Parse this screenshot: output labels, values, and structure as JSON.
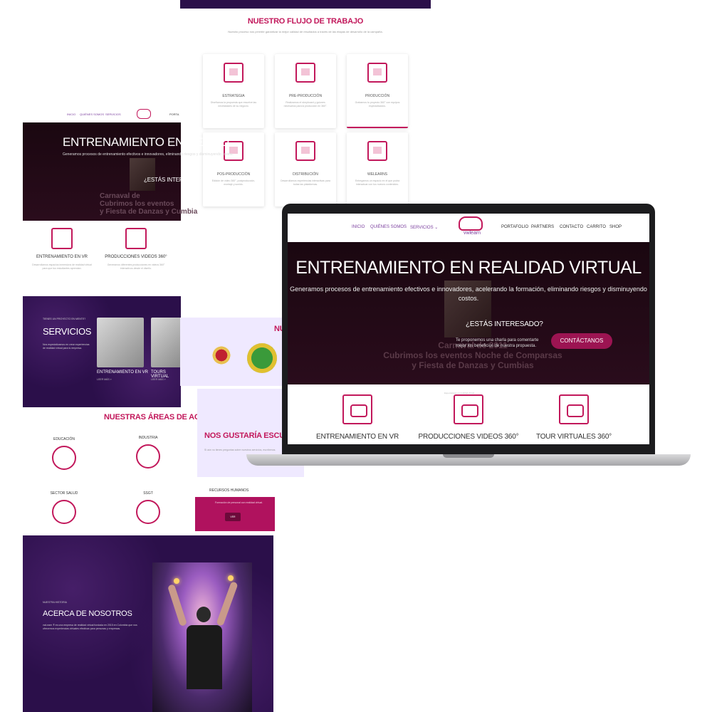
{
  "workflow": {
    "title": "NUESTRO FLUJO DE TRABAJO",
    "subtitle": "Nuestro proceso nos permite garantizar la mejor calidad de resultados a través de las etapas de desarrollo de la campaña.",
    "cards": [
      {
        "label": "ESTRATEGIA",
        "text": "Diseñamos la propuesta que resuelve las necesidades de su negocio."
      },
      {
        "label": "PRE-PRODUCCIÓN",
        "text": "Realizamos el storyboard y guiones necesarios para la producción en 360°."
      },
      {
        "label": "PRODUCCIÓN",
        "text": "Grabamos tu proyecto 360° con equipos especializados."
      },
      {
        "label": "POS-PRODUCCIÓN",
        "text": "Edición de video 360°, postproducción, montaje y sonido."
      },
      {
        "label": "DISTRIBUCIÓN",
        "text": "Desarrollamos experiencias interactivas para todas las plataformas."
      },
      {
        "label": "WELEARNS",
        "text": "Entregamos un espacio en el que podrá interactuar con tus nuevos contenidos."
      }
    ]
  },
  "left_page": {
    "nav": [
      "INICIO",
      "QUIÉNES SOMOS",
      "SERVICIOS",
      "PORTA"
    ],
    "hero": {
      "title": "ENTRENAMIENTO EN REALID",
      "text": "Generamos procesos de entrenamiento efectivos e innovadores, eliminando riesgos y disminuyendo costos.",
      "question": "¿ESTÁS INTERESAD",
      "carnaval": "Carnaval de\nCubrimos los eventos\ny Fiesta de Danzas y Cumbia"
    },
    "services": [
      {
        "name": "ENTRENAMIENTO EN VR",
        "desc": "Desarrollamos espacios inmersivos de realidad virtual para que tus estudiantes aprendan."
      },
      {
        "name": "PRODUCCIONES VIDEOS 360°",
        "desc": "Generamos diferentes producciones en videos 360° interactivos desde el diseño."
      }
    ],
    "servicios": {
      "tag": "TIENES UN PROYECTO EN MENTE?",
      "title": "SERVICIOS",
      "desc": "Nos especializamos en crear experiencias de realidad virtual para tu empresa.",
      "items": [
        {
          "name": "ENTRENAMIENTO EN VR",
          "more": "LEER MÁS »"
        },
        {
          "name": "TOURS VIRTUAL",
          "more": "LEER MÁS »"
        }
      ]
    },
    "areas": {
      "title": "NUESTRAS ÁREAS DE ACC",
      "items": [
        "EDUCACIÓN",
        "INDUSTRIA",
        "SECTOR SALUD",
        "SSGT"
      ]
    },
    "about": {
      "tag": "NUESTRA HISTORIA",
      "title": "ACERCA DE NOSOTROS",
      "desc": "vwLearn ® es una empresa de realidad virtual fundada en 2015 en Colombia que nos ofrecemos experiencias virtuales efectivas para personas y empresas."
    }
  },
  "partners": {
    "title": "NU"
  },
  "contact": {
    "title": "NOS GUSTARÍA ESCUCHAR",
    "text": "Si aún no tienes preguntas sobre nuestros servicios, escríbenos."
  },
  "rrhh": {
    "name": "RECURSOS HUMANOS",
    "text": "Formación de personal con realidad virtual.",
    "button": "VER"
  },
  "laptop": {
    "nav_left": [
      "INICIO",
      "QUIÉNES SOMOS",
      "SERVICIOS ⌄"
    ],
    "logo_word": "vwlearn",
    "nav_right": [
      "PORTAFOLIO",
      "PARTNERS",
      "CONTACTO",
      "CARRITO",
      "SHOP"
    ],
    "hero": {
      "title": "ENTRENAMIENTO EN REALIDAD VIRTUAL",
      "text": "Generamos procesos de entrenamiento efectivos e innovadores, acelerando la formación, eliminando riesgos y disminuyendo costos.",
      "question": "¿ESTÁS INTERESADO?",
      "small": "Te proponemos una charla para comentarte mejor los beneficios de nuestra propuesta.",
      "cta": "CONTÁCTANOS",
      "carnaval": "Carnaval de 2011\nCubrimos los eventos Noche de Comparsas\ny Fiesta de Danzas y Cumbias"
    },
    "services": [
      "ENTRENAMIENTO EN VR",
      "PRODUCCIONES VIDEOS 360°",
      "TOUR VIRTUALES 360°"
    ],
    "micro": "Especialistas en realidad virtual"
  },
  "colors": {
    "accent": "#c2185b",
    "purple": "#7b3f9e",
    "dark_purple": "#2b0f4a"
  }
}
